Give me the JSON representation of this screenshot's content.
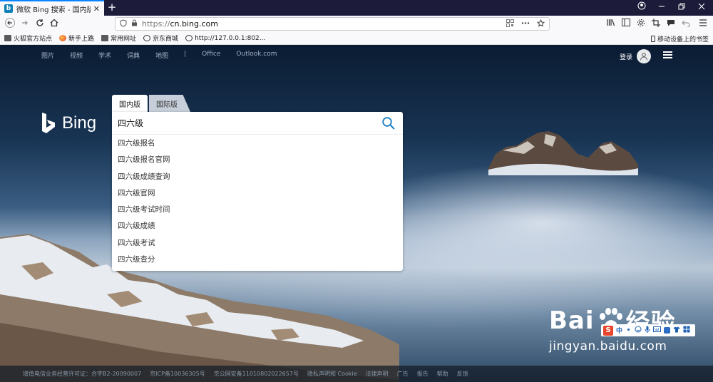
{
  "browser": {
    "tab_title": "微软 Bing 搜索 - 国内版",
    "tab_favicon_letter": "b",
    "tab_close": "✕",
    "new_tab": "+",
    "url_protocol": "https://",
    "url_host": "cn.bing.com",
    "bookmarks": [
      {
        "label": "火狐官方站点",
        "icon": "folder"
      },
      {
        "label": "新手上路",
        "icon": "firefox"
      },
      {
        "label": "常用网址",
        "icon": "folder"
      },
      {
        "label": "京东商城",
        "icon": "globe"
      },
      {
        "label": "http://127.0.0.1:802...",
        "icon": "globe"
      }
    ],
    "mobile_bookmarks": "移动设备上的书签"
  },
  "bing": {
    "nav": [
      "图片",
      "视频",
      "学术",
      "词典",
      "地图",
      "|",
      "Office",
      "Outlook.com"
    ],
    "login_label": "登录",
    "logo_text": "Bing",
    "tabs": {
      "domestic": "国内版",
      "international": "国际版"
    },
    "query": "四六级",
    "suggestions": [
      "四六级报名",
      "四六级报名官网",
      "四六级成绩查询",
      "四六级官网",
      "四六级考试时间",
      "四六级成绩",
      "四六级考试",
      "四六级查分"
    ],
    "footer": [
      "增值电信业务经营许可证：合字B2-20090007",
      "京ICP备10036305号",
      "京公网安备11010802022657号",
      "隐私声明和 Cookie",
      "法律声明",
      "广告",
      "报告",
      "帮助",
      "反馈"
    ]
  },
  "watermark": {
    "big_left": "Bai",
    "big_right": "经验",
    "small": "jingyan.baidu.com"
  },
  "ime": {
    "logo": "S",
    "mode": "中"
  },
  "colors": {
    "accent": "#0a84ff",
    "bing_blue": "#0c7bb3",
    "search_icon": "#1a7cc1"
  }
}
